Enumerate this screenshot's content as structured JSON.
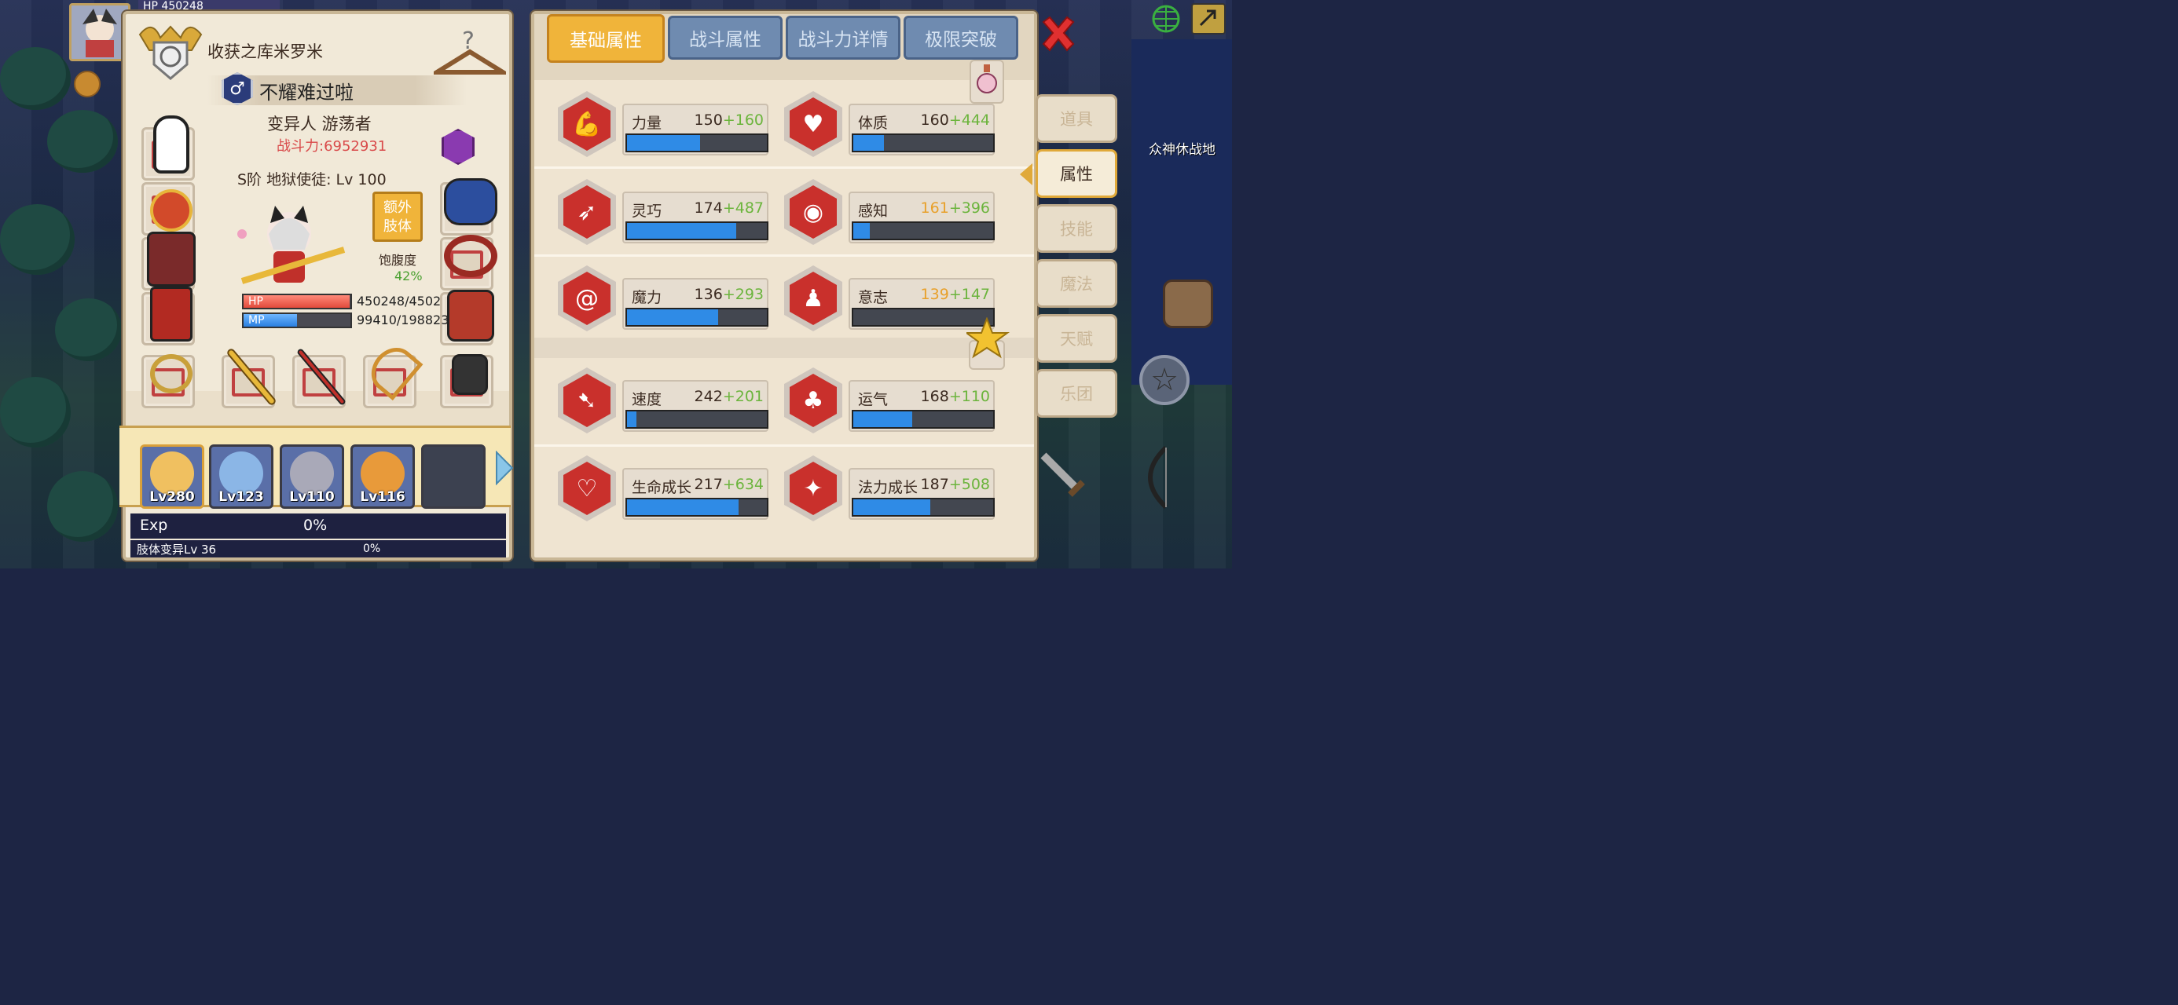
{
  "hud": {
    "top_hp_fragment": "HP  450248",
    "area_name": "众神休战地"
  },
  "character": {
    "title": "收获之库米罗米",
    "name": "不耀难过啦",
    "race_class": "变异人 游荡者",
    "power": "战斗力:6952931",
    "rank": "S阶 地狱使徒: Lv 100",
    "extra_limb_button": "额外\n肢体",
    "satiety_label": "饱腹度",
    "satiety_value": "42%",
    "hp_label": "HP",
    "hp_text": "450248/4502",
    "hp_fraction": 0.99,
    "mp_label": "MP",
    "mp_text": "99410/198823",
    "mp_fraction": 0.5
  },
  "party": [
    {
      "level": "Lv280",
      "color": "#f0c060"
    },
    {
      "level": "Lv123",
      "color": "#8bb6e6"
    },
    {
      "level": "Lv110",
      "color": "#a9a9b8"
    },
    {
      "level": "Lv116",
      "color": "#e89a3a"
    }
  ],
  "exp": {
    "label": "Exp",
    "percent": "0%",
    "mutation_label": "肢体变异Lv 36",
    "mutation_percent": "0%"
  },
  "tabs": [
    "基础属性",
    "战斗属性",
    "战斗力详情",
    "极限突破"
  ],
  "stats": [
    {
      "name": "力量",
      "base": "150",
      "bonus": "+160",
      "fill": 0.52,
      "icon": "muscle-icon",
      "orange": false
    },
    {
      "name": "体质",
      "base": "160",
      "bonus": "+444",
      "fill": 0.22,
      "icon": "heart-body-icon",
      "orange": false
    },
    {
      "name": "灵巧",
      "base": "174",
      "bonus": "+487",
      "fill": 0.78,
      "icon": "running-icon",
      "orange": false
    },
    {
      "name": "感知",
      "base": "161",
      "bonus": "+396",
      "fill": 0.12,
      "icon": "eye-icon",
      "orange": true
    },
    {
      "name": "魔力",
      "base": "136",
      "bonus": "+293",
      "fill": 0.65,
      "icon": "spiral-icon",
      "orange": false
    },
    {
      "name": "意志",
      "base": "139",
      "bonus": "+147",
      "fill": 0.0,
      "icon": "head-icon",
      "orange": true
    },
    {
      "name": "速度",
      "base": "242",
      "bonus": "+201",
      "fill": 0.07,
      "icon": "wing-icon",
      "orange": false
    },
    {
      "name": "运气",
      "base": "168",
      "bonus": "+110",
      "fill": 0.42,
      "icon": "clover-icon",
      "orange": false
    },
    {
      "name": "生命成长",
      "base": "217",
      "bonus": "+634",
      "fill": 0.8,
      "icon": "heart-growth-icon",
      "orange": false
    },
    {
      "name": "法力成长",
      "base": "187",
      "bonus": "+508",
      "fill": 0.55,
      "icon": "mana-growth-icon",
      "orange": false
    }
  ],
  "side_tabs": [
    "道具",
    "属性",
    "技能",
    "魔法",
    "天赋",
    "乐团"
  ],
  "colors": {
    "accent_tab": "#f0b43a",
    "stat_bonus": "#6bb43c",
    "stat_base_orange": "#e8a02a",
    "power_red": "#d94a4a",
    "bar_blue": "#2f8be6"
  }
}
